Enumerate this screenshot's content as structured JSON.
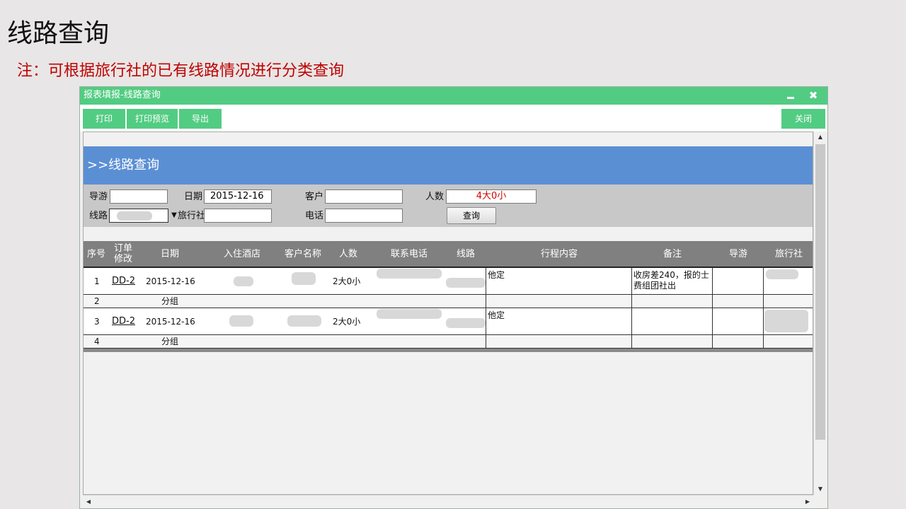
{
  "slide": {
    "title": "线路查询",
    "note": "注：可根据旅行社的已有线路情况进行分类查询"
  },
  "window": {
    "title": "报表填报-线路查询",
    "minimize_icon": "minimize-icon",
    "close_glyph": "✖",
    "accent_color": "#52cc82"
  },
  "toolbar": {
    "print": "打印",
    "print_preview": "打印预览",
    "export": "导出",
    "close": "关闭"
  },
  "banner": {
    "title": ">>线路查询",
    "color": "#5b8fd4"
  },
  "filter": {
    "guide_label": "导游",
    "guide_value": "",
    "date_label": "日期",
    "date_value": "2015-12-16",
    "customer_label": "客户",
    "customer_value": "",
    "people_label": "人数",
    "people_value": "4大0小",
    "route_label": "线路",
    "agency_label": "旅行社",
    "agency_value": "",
    "phone_label": "电话",
    "phone_value": "",
    "query_button": "查询"
  },
  "grid": {
    "columns": [
      "序号",
      "订单修改",
      "日期",
      "入住酒店",
      "客户名称",
      "人数",
      "联系电话",
      "线路",
      "行程内容",
      "备注",
      "导游",
      "旅行社"
    ],
    "rows": [
      {
        "no": "1",
        "order": "DD-2",
        "date": "2015-12-16",
        "people": "2大0小",
        "itinerary": "他定",
        "remark": "收房差240，报的士费组团社出"
      },
      {
        "no": "2",
        "group": "分组"
      },
      {
        "no": "3",
        "order": "DD-2",
        "date": "2015-12-16",
        "people": "2大0小",
        "itinerary": "他定",
        "remark": ""
      },
      {
        "no": "4",
        "group": "分组"
      }
    ]
  }
}
